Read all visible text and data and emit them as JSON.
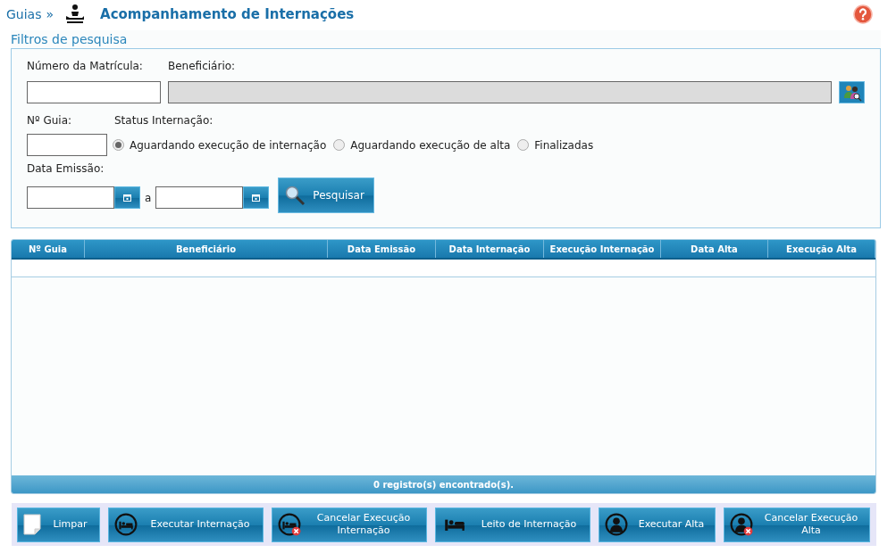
{
  "breadcrumb": {
    "root": "Guias",
    "separator": "»",
    "title": "Acompanhamento de Internações"
  },
  "filters": {
    "legend": "Filtros de pesquisa",
    "matricula": {
      "label": "Número da Matrícula:"
    },
    "beneficiario": {
      "label": "Beneficiário:",
      "disabled": true
    },
    "guia": {
      "label": "Nº Guia:"
    },
    "status": {
      "label": "Status Internação:",
      "options": [
        {
          "label": "Aguardando execução de internação",
          "selected": true
        },
        {
          "label": "Aguardando execução de alta",
          "selected": false
        },
        {
          "label": "Finalizadas",
          "selected": false
        }
      ]
    },
    "data_emissao": {
      "label": "Data Emissão:",
      "between": "a"
    },
    "search_button": "Pesquisar"
  },
  "table": {
    "columns": [
      "Nº Guia",
      "Beneficiário",
      "Data Emissão",
      "Data Internação",
      "Execução Internação",
      "Data Alta",
      "Execução Alta"
    ],
    "footer": "0 registro(s) encontrado(s)."
  },
  "actions": [
    {
      "kind": "page",
      "label": "Limpar"
    },
    {
      "kind": "bed-circle",
      "label": "Executar Internação"
    },
    {
      "kind": "bed-cancel",
      "label": "Cancelar Execução Internação"
    },
    {
      "kind": "bed",
      "label": "Leito de Internação"
    },
    {
      "kind": "person",
      "label": "Executar Alta"
    },
    {
      "kind": "person-cancel",
      "label": "Cancelar Execução Alta"
    }
  ]
}
